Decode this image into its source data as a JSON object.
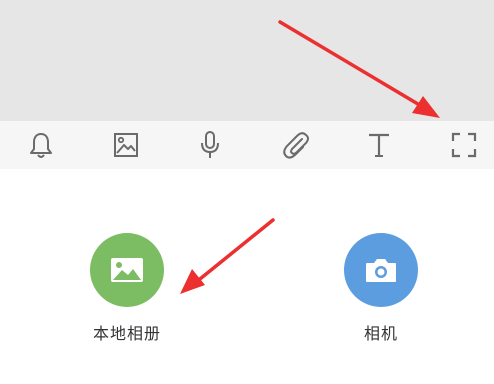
{
  "toolbar": {
    "icons": [
      "bell-icon",
      "image-icon",
      "microphone-icon",
      "paperclip-icon",
      "text-icon",
      "fullscreen-icon"
    ]
  },
  "actions": {
    "local_album": {
      "label": "本地相册",
      "icon": "image-icon",
      "color": "#7cbd63"
    },
    "camera": {
      "label": "相机",
      "icon": "camera-icon",
      "color": "#5c9de0"
    }
  },
  "colors": {
    "top_area": "#e6e6e6",
    "toolbar_bg": "#f6f6f6",
    "icon": "#6b6b6b",
    "annotation_arrow": "#ec2f2f"
  }
}
